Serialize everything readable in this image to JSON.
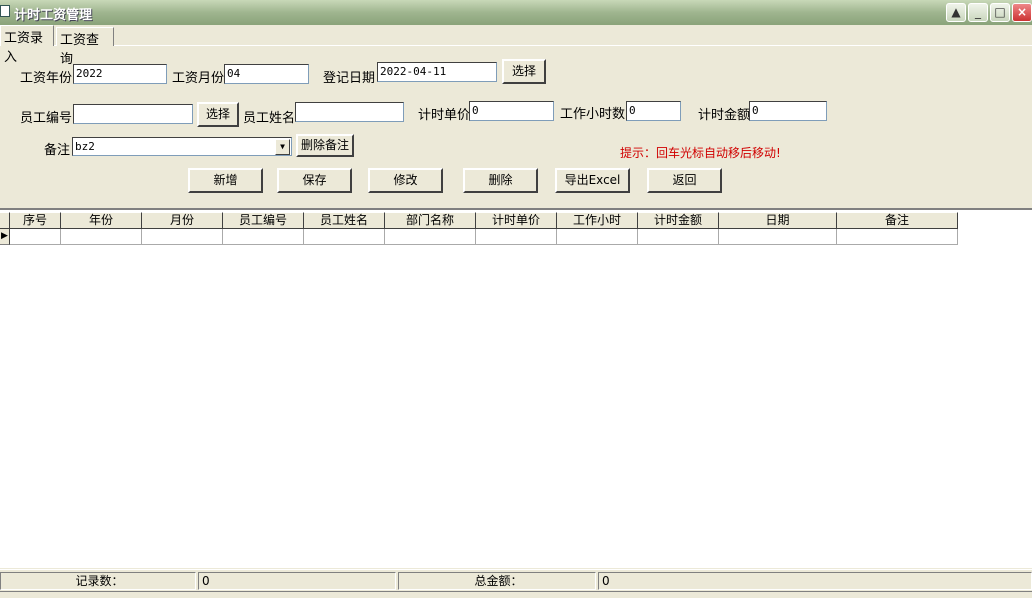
{
  "window": {
    "title": "计时工资管理",
    "min": "_",
    "max": "□",
    "close": "×"
  },
  "tabs": [
    {
      "label": "工资录入"
    },
    {
      "label": "工资查询"
    }
  ],
  "form": {
    "year_label": "工资年份",
    "year_value": "2022",
    "month_label": "工资月份",
    "month_value": "04",
    "date_label": "登记日期",
    "date_value": "2022-04-11",
    "date_select_button": "选择",
    "emp_no_label": "员工编号",
    "emp_no_value": "",
    "emp_select_button": "选择",
    "emp_name_label": "员工姓名",
    "emp_name_value": "",
    "unit_price_label": "计时单价",
    "unit_price_value": "0",
    "hours_label": "工作小时数",
    "hours_value": "0",
    "amount_label": "计时金额",
    "amount_value": "0",
    "remark_label": "备注",
    "remark_value": "bz2",
    "delete_remark_button": "删除备注",
    "hint": "提示：回车光标自动移后移动!"
  },
  "actions": {
    "add": "新增",
    "save": "保存",
    "edit": "修改",
    "delete": "删除",
    "export": "导出Excel",
    "back": "返回"
  },
  "grid": {
    "columns": [
      "序号",
      "年份",
      "月份",
      "员工编号",
      "员工姓名",
      "部门名称",
      "计时单价",
      "工作小时",
      "计时金额",
      "日期",
      "备注"
    ]
  },
  "status": {
    "count_label": "记录数：",
    "count_value": "0",
    "total_label": "总金额：",
    "total_value": "0"
  }
}
